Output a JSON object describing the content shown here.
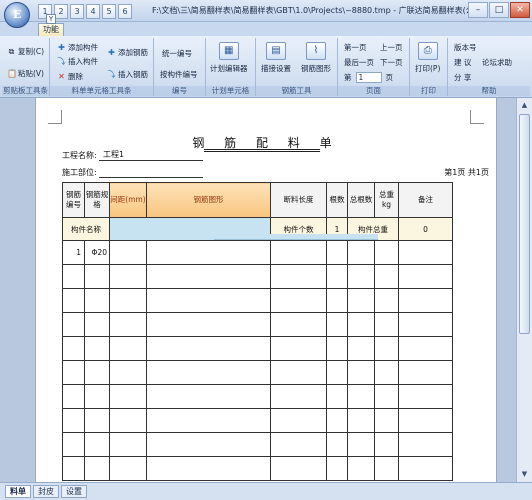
{
  "window": {
    "title": "F:\\文档\\三\\简易翻样表\\简易翻样表\\GBT\\1.0\\Projects\\~8880.tmp - 广联达简易翻样表(公...",
    "app_button_label": "E",
    "quick_access": [
      "1",
      "2",
      "3",
      "4",
      "5",
      "6"
    ],
    "controls": {
      "minimize": "–",
      "maximize": "□",
      "close": "✕"
    }
  },
  "ribbon": {
    "tab_label": "功能",
    "key_tip": "Y",
    "groups": {
      "clipboard": {
        "label": "剪贴板工具条",
        "copy": "复制(C)",
        "paste": "粘贴(V)"
      },
      "unit": {
        "label": "料单单元格工具条",
        "add_component": "添加构件",
        "insert_component": "插入构件",
        "delete": "删除",
        "add_rebar": "添加钢筋",
        "insert_rebar": "插入钢筋"
      },
      "number": {
        "label": "编号",
        "unify": "统一编号",
        "by_component": "按构件编号"
      },
      "calc": {
        "label": "计划单元格",
        "editor": "计划编辑器"
      },
      "rebar_tools": {
        "label": "钢筋工具",
        "inspect_settings": "描接设置",
        "rebar_shape": "钢筋图形"
      },
      "page": {
        "label": "页面",
        "first": "第一页",
        "prev": "上一页",
        "last": "最后一页",
        "next": "下一页",
        "page_prefix": "第",
        "page_value": "1",
        "page_suffix": "页"
      },
      "print": {
        "label": "打印",
        "print": "打印(P)"
      },
      "help": {
        "label": "帮助",
        "version": "版本号",
        "suggest": "建 议",
        "forum": "论坛求助",
        "share": "分 享"
      }
    }
  },
  "document": {
    "title": "钢 筋 配 料 单",
    "project_label": "工程名称:",
    "project_value": "工程1",
    "site_label": "施工部位:",
    "page_info": "第1页 共1页",
    "headers": [
      "钢筋编号",
      "钢筋规格",
      "间距(mm)",
      "钢筋图形",
      "断料长度",
      "根数",
      "总根数",
      "总重kg",
      "备注"
    ],
    "component_row": {
      "name_label": "构件名称",
      "count_label": "构件个数",
      "count_value": "1",
      "total_weight_label": "构件总重",
      "weight_value": "0"
    },
    "rows": [
      {
        "no": "1",
        "spec": "Φ20"
      }
    ]
  },
  "sheet_tabs": [
    "料单",
    "封皮",
    "设置"
  ],
  "active_sheet": "料单",
  "scrollbar": {
    "up": "▲",
    "down": "▼"
  }
}
